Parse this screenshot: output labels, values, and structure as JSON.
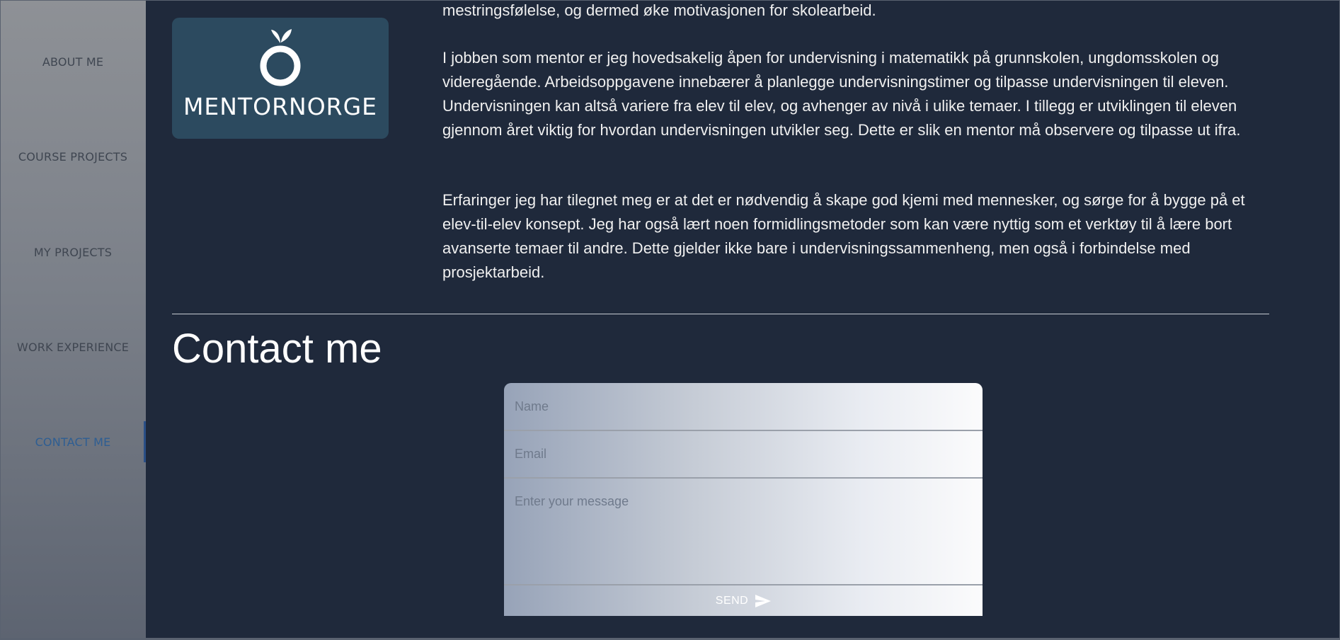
{
  "sidebar": {
    "items": [
      {
        "label": "ABOUT ME",
        "active": false
      },
      {
        "label": "COURSE PROJECTS",
        "active": false
      },
      {
        "label": "MY PROJECTS",
        "active": false
      },
      {
        "label": "WORK EXPERIENCE",
        "active": false
      },
      {
        "label": "CONTACT ME",
        "active": true
      }
    ]
  },
  "logo": {
    "text": "MENTORNORGE"
  },
  "content": {
    "paragraph_top": "mestringsfølelse, og dermed øke motivasjonen for skolearbeid.",
    "paragraph_1": "I jobben som mentor er jeg hovedsakelig åpen for undervisning i matematikk på grunnskolen, ungdomsskolen og videregående. Arbeidsoppgavene innebærer å planlegge undervisningstimer og tilpasse undervisningen til eleven. Undervisningen kan altså variere fra elev til elev, og avhenger av nivå i ulike temaer. I tillegg er utviklingen til eleven gjennom året viktig for hvordan undervisningen utvikler seg. Dette er slik en mentor må observere og tilpasse ut ifra.",
    "paragraph_2": "Erfaringer jeg har tilegnet meg er at det er nødvendig å skape god kjemi med mennesker, og sørge for å bygge på et elev-til-elev konsept. Jeg har også lært noen formidlingsmetoder som kan være nyttig som et verktøy til å lære bort avanserte temaer til andre. Dette gjelder ikke bare i undervisningssammenheng, men også i forbindelse med prosjektarbeid."
  },
  "contact": {
    "title": "Contact me",
    "name_placeholder": "Name",
    "email_placeholder": "Email",
    "message_placeholder": "Enter your message",
    "send_label": "SEND"
  },
  "colors": {
    "page_background": "#1f293b",
    "active_nav": "#2e5e93",
    "logo_background": "#2c4a5f"
  },
  "icons": [
    "orange-fruit-icon",
    "send-icon"
  ]
}
